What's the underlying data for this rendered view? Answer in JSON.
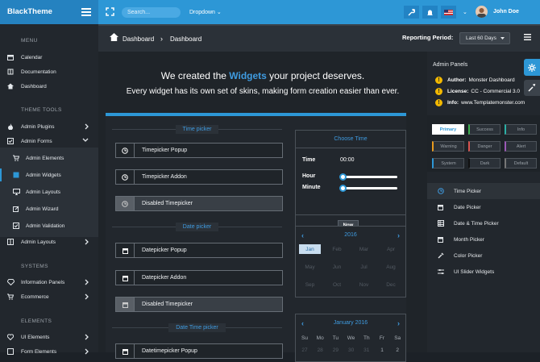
{
  "brand": {
    "name": "BlackTheme"
  },
  "topbar": {
    "search_placeholder": "Search...",
    "dropdown_label": "Dropdown",
    "user_name": "John Doe"
  },
  "sidebar": {
    "sections": [
      {
        "title": "MENU"
      },
      {
        "title": "THEME TOOLS"
      },
      {
        "title": "SYSTEMS"
      },
      {
        "title": "ELEMENTS"
      }
    ],
    "items": [
      {
        "label": "Calendar",
        "icon": "calendar-icon"
      },
      {
        "label": "Documentation",
        "icon": "book-icon"
      },
      {
        "label": "Dashboard",
        "icon": "home-icon"
      },
      {
        "label": "Admin Plugins",
        "icon": "fire-icon",
        "has_children": true
      },
      {
        "label": "Admin Forms",
        "icon": "check-square-icon",
        "has_children": true,
        "expanded": true
      },
      {
        "label": "Admin Elements",
        "icon": "cart-icon",
        "sub": true
      },
      {
        "label": "Admin Widgets",
        "icon": "table-icon",
        "sub": true,
        "active": true
      },
      {
        "label": "Admin Layouts",
        "icon": "desktop-icon",
        "sub": true
      },
      {
        "label": "Admin Wizard",
        "icon": "pencil-icon",
        "sub": true
      },
      {
        "label": "Admin Validation",
        "icon": "check-square-icon",
        "sub": true
      },
      {
        "label": "Admin Layouts",
        "icon": "columns-icon",
        "has_children": true
      },
      {
        "label": "Information Panels",
        "icon": "diamond-icon",
        "has_children": true
      },
      {
        "label": "Ecommerce",
        "icon": "cart-icon",
        "has_children": true
      },
      {
        "label": "UI Elements",
        "icon": "heart-icon",
        "has_children": true
      },
      {
        "label": "Form Elements",
        "icon": "form-icon",
        "has_children": true
      }
    ]
  },
  "breadcrumb": {
    "home": "Dashboard",
    "current": "Dashboard"
  },
  "reporting": {
    "label": "Reporting Period:",
    "value": "Last 60 Days"
  },
  "hero": {
    "line1_before": "We created the ",
    "line1_highlight": "Widgets",
    "line1_after": " your project deserves.",
    "line2": "Every widget has its own set of skins, making form creation easier than ever."
  },
  "sections": {
    "timepicker": "Time picker",
    "datepicker": "Date picker",
    "datetimepicker": "Date Time picker"
  },
  "fields": {
    "timepicker_popup": "Timepicker Popup",
    "timepicker_addon": "Timepicker Addon",
    "disabled_timepicker": "Disabled Timepicker",
    "datepicker_popup": "Datepicker Popup",
    "datepicker_addon": "Datepicker Addon",
    "disabled_timepicker_2": "Disabled Timepicker",
    "datetimepicker_popup": "Datetimepicker Popup"
  },
  "choose_time": {
    "title": "Choose Time",
    "time_label": "Time",
    "time_value": "00:00",
    "hour_label": "Hour",
    "minute_label": "Minute",
    "hour_value": 0,
    "minute_value": 0,
    "now_button": "Now"
  },
  "year_cal": {
    "year": "2016",
    "months": [
      "Jan",
      "Feb",
      "Mar",
      "Apr",
      "May",
      "Jun",
      "Jul",
      "Aug",
      "Sep",
      "Oct",
      "Nov",
      "Dec"
    ],
    "selected": "Jan"
  },
  "month_cal": {
    "title": "January 2016",
    "weekdays": [
      "Su",
      "Mo",
      "Tu",
      "We",
      "Th",
      "Fr",
      "Sa"
    ],
    "first_row": [
      "27",
      "28",
      "29",
      "30",
      "31",
      "1",
      "2"
    ]
  },
  "right_panel": {
    "title": "Admin Panels",
    "info": [
      {
        "key": "Author:",
        "value": "Monster Dashboard"
      },
      {
        "key": "License:",
        "value": "CC - Commercial 3.0"
      },
      {
        "key": "Info:",
        "value": "www.Templatemonster.com"
      }
    ],
    "skins": [
      "Primary",
      "Success",
      "Info",
      "Warning",
      "Danger",
      "Alert",
      "System",
      "Dark",
      "Default"
    ],
    "widgets": [
      {
        "label": "Time Picker",
        "icon": "clock-icon",
        "active": true
      },
      {
        "label": "Date Picker",
        "icon": "calendar-icon"
      },
      {
        "label": "Date & Time Picker",
        "icon": "table-icon"
      },
      {
        "label": "Month Picker",
        "icon": "calendar-icon"
      },
      {
        "label": "Color Picker",
        "icon": "eyedropper-icon"
      },
      {
        "label": "UI Slider Widgets",
        "icon": "sliders-icon"
      }
    ]
  },
  "colors": {
    "accent": "#2d97d6",
    "topbar": "#2d97d6",
    "background": "#1c2127",
    "warning": "#f2b800"
  }
}
